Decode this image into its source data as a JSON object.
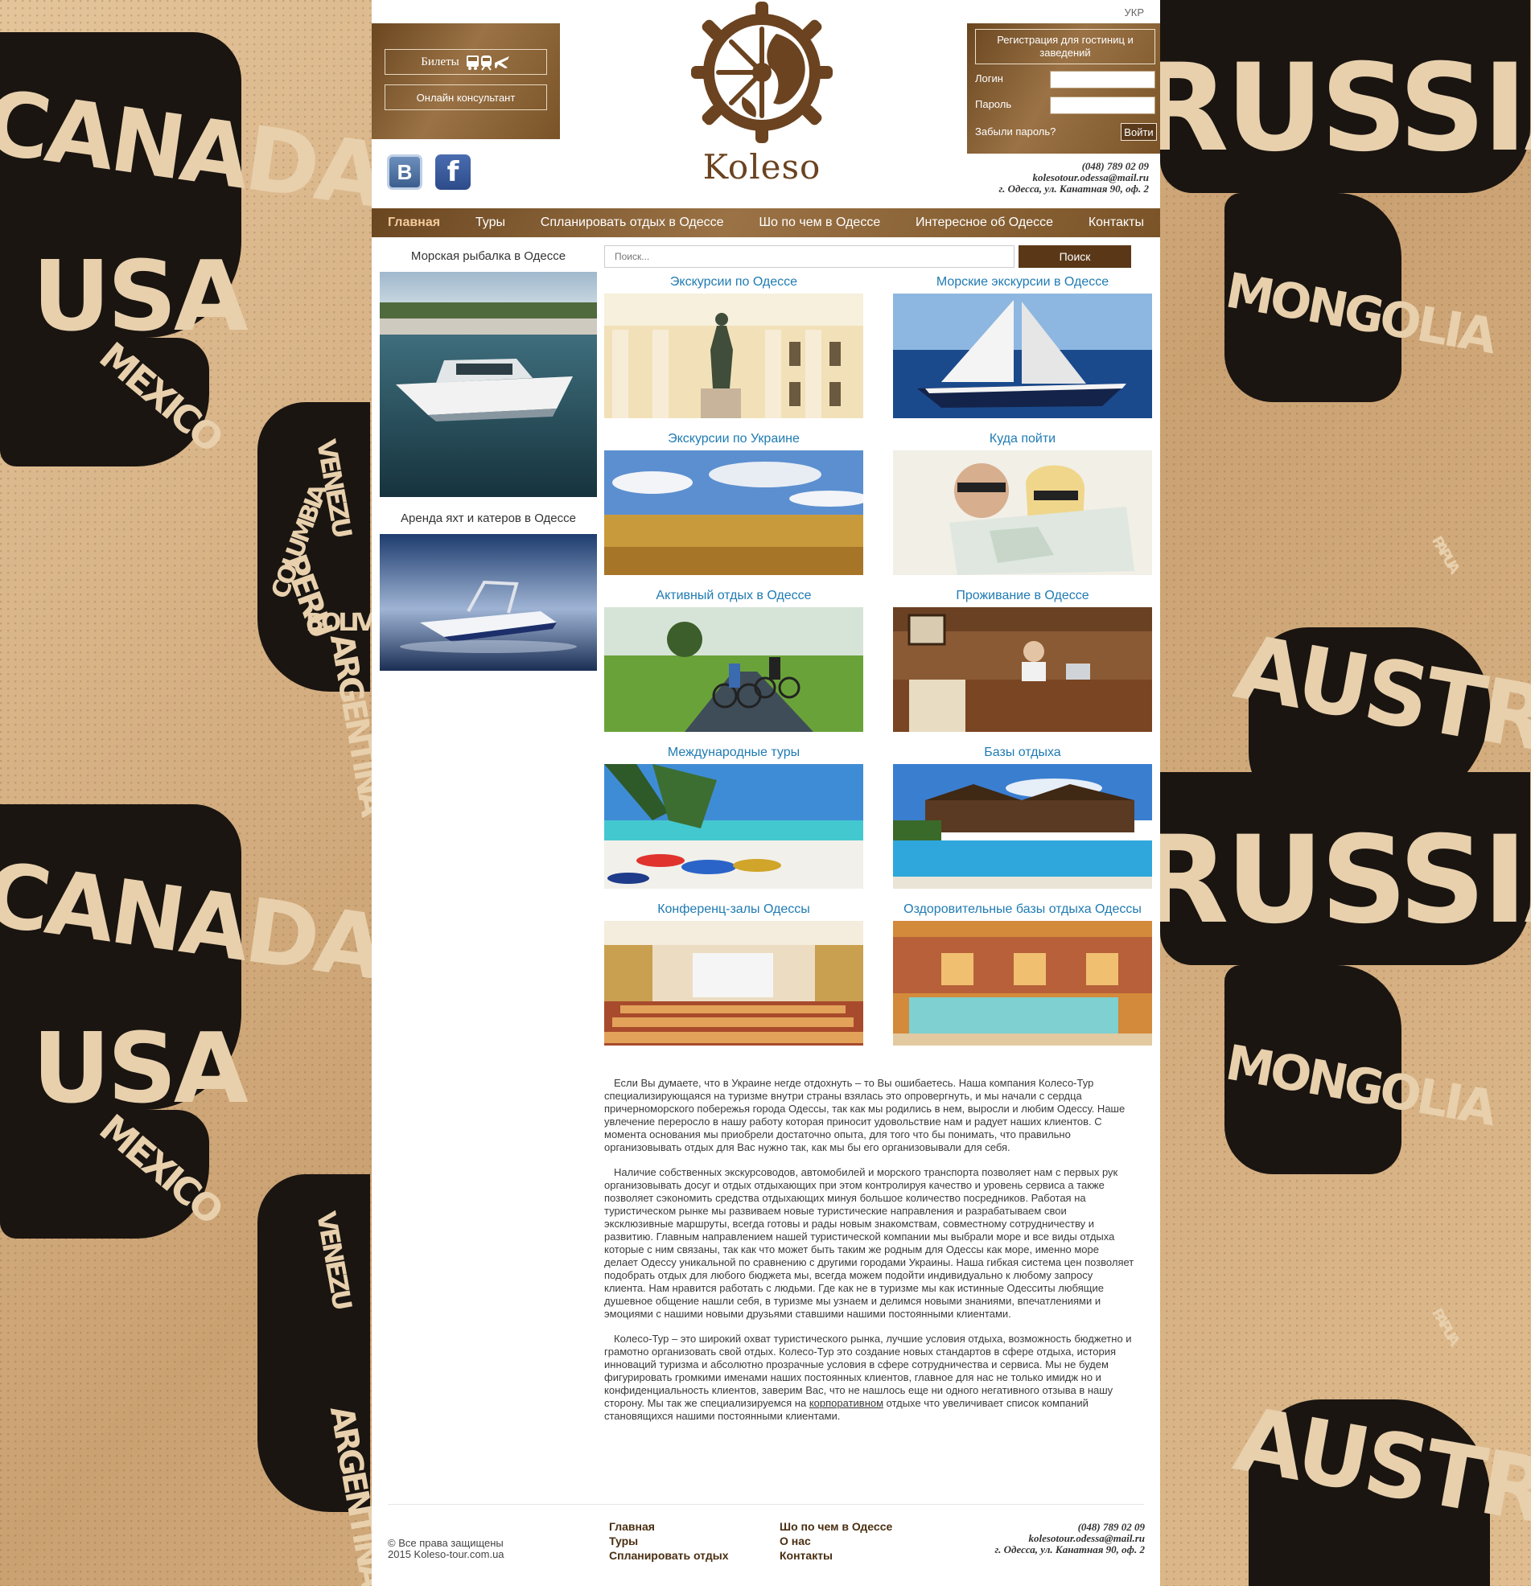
{
  "header": {
    "lang": "УКР",
    "tickets_label": "Билеты",
    "online_label": "Онлайн консультант",
    "social": {
      "vk": "В",
      "fb": "f"
    },
    "logo_text": "Koleso",
    "login": {
      "register_label": "Регистрация для гостиниц и заведений",
      "login_label": "Логин",
      "password_label": "Пароль",
      "forgot_label": "Забыли пароль?",
      "submit_label": "Войти"
    },
    "contacts": {
      "phone": "(048) 789 02 09",
      "email": "kolesotour.odessa@mail.ru",
      "address": "г. Одесса, ул. Канатная 90, оф. 2"
    }
  },
  "nav": [
    "Главная",
    "Туры",
    "Спланировать отдых в Одессе",
    "Шо по чем в Одессе",
    "Интересное об Одессе",
    "Контакты"
  ],
  "sidebar": [
    {
      "title": "Морская рыбалка в Одессе"
    },
    {
      "title": "Аренда яхт и катеров в Одессе"
    }
  ],
  "search": {
    "placeholder": "Поиск...",
    "button": "Поиск"
  },
  "tiles": [
    {
      "title": "Экскурсии по Одессе"
    },
    {
      "title": "Морские экскурсии в Одессе"
    },
    {
      "title": "Экскурсии по Украине"
    },
    {
      "title": "Куда пойти"
    },
    {
      "title": "Активный отдых в Одессе"
    },
    {
      "title": "Проживание в Одессе"
    },
    {
      "title": "Международные туры"
    },
    {
      "title": "Базы отдыха"
    },
    {
      "title": "Конференц-залы Одессы"
    },
    {
      "title": "Оздоровительные базы отдыха Одессы"
    }
  ],
  "article": {
    "p1": "Если Вы думаете, что в Украине негде отдохнуть – то Вы ошибаетесь. Наша компания Колесо-Тур специализирующаяся на туризме внутри страны взялась это опровергнуть, и мы начали с сердца причерноморского побережья города Одессы, так как мы родились в нем, выросли и любим Одессу. Наше увлечение переросло в нашу работу которая приносит удовольствие нам и радует наших клиентов. С момента основания мы приобрели достаточно опыта, для того что бы понимать, что правильно организовывать отдых для Вас нужно так, как мы бы его организовывали для себя.",
    "p2": "Наличие собственных экскурсоводов, автомобилей и морского транспорта позволяет нам с первых рук организовывать досуг и отдых отдыхающих при этом контролируя качество и уровень сервиса а также позволяет сэкономить средства отдыхающих минуя большое количество посредников. Работая на туристическом рынке мы развиваем новые туристические направления и разрабатываем свои эксклюзивные маршруты, всегда готовы и рады новым знакомствам, совместному сотрудничеству и развитию. Главным направлением нашей туристической компании мы выбрали море и все виды отдыха которые с ним связаны, так как что может быть таким же родным для Одессы как море, именно море делает Одессу уникальной по сравнению с другими городами Украины. Наша гибкая система цен позволяет подобрать отдых для любого бюджета мы, всегда можем подойти индивидуально к любому запросу клиента. Нам нравится работать с людьми. Где как не в туризме мы как истинные Одесситы любящие душевное общение нашли себя, в туризме мы узнаем и делимся новыми знаниями, впечатлениями и эмоциями с нашими новыми друзьями ставшими нашими постоянными клиентами.",
    "p3_before": "Колесо-Тур – это широкий охват туристического рынка, лучшие условия отдыха, возможность бюджетно и грамотно организовать свой отдых. Колесо-Тур это создание новых стандартов в сфере отдыха, история инноваций туризма и абсолютно прозрачные условия в сфере сотрудничества и сервиса. Мы не будем фигурировать громкими именами наших постоянных клиентов, главное для нас не только имидж но и конфиденциальность клиентов, заверим Вас, что не нашлось еще ни одного негативного отзыва в нашу сторону. Мы так же специализируемся на ",
    "p3_link": "корпоративном",
    "p3_after": " отдыхе что увеличивает список компаний становящихся нашими постоянными клиентами."
  },
  "footer": {
    "copyright_1": "© Все права защищены",
    "copyright_2": "2015 Koleso-tour.com.ua",
    "nav_col1": [
      "Главная",
      "Туры",
      "Спланировать отдых"
    ],
    "nav_col2": [
      "Шо по чем в Одессе",
      "О нас",
      "Контакты"
    ],
    "phone": "(048) 789 02 09",
    "email": "kolesotour.odessa@mail.ru",
    "address": "г. Одесса, ул. Канатная 90, оф. 2"
  },
  "background_map_labels": {
    "canada": "CANADA",
    "usa": "USA",
    "mexico": "MEXICO",
    "venezuela": "VENEZU",
    "colombia": "COLUMBIA",
    "peru": "PERU",
    "bolivia": "BOLIVIA",
    "argentina": "ARGENTINA",
    "russia": "RUSSIA",
    "mongolia": "MONGOLIA",
    "papua": "PAPUA",
    "australia": "AUSTRALIA"
  },
  "colors": {
    "brand_brown": "#6a4620",
    "link_blue": "#1f7bb3",
    "bg_tan": "#d9b385"
  }
}
